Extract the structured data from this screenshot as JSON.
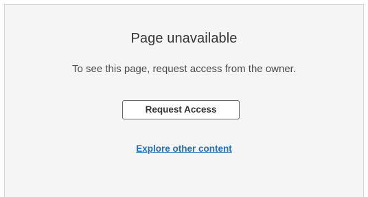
{
  "dialog": {
    "title": "Page unavailable",
    "message": "To see this page, request access from the owner.",
    "request_button_label": "Request Access",
    "explore_link_label": "Explore other content"
  },
  "colors": {
    "panel_background": "#f5f5f5",
    "link": "#1f6fb5"
  }
}
